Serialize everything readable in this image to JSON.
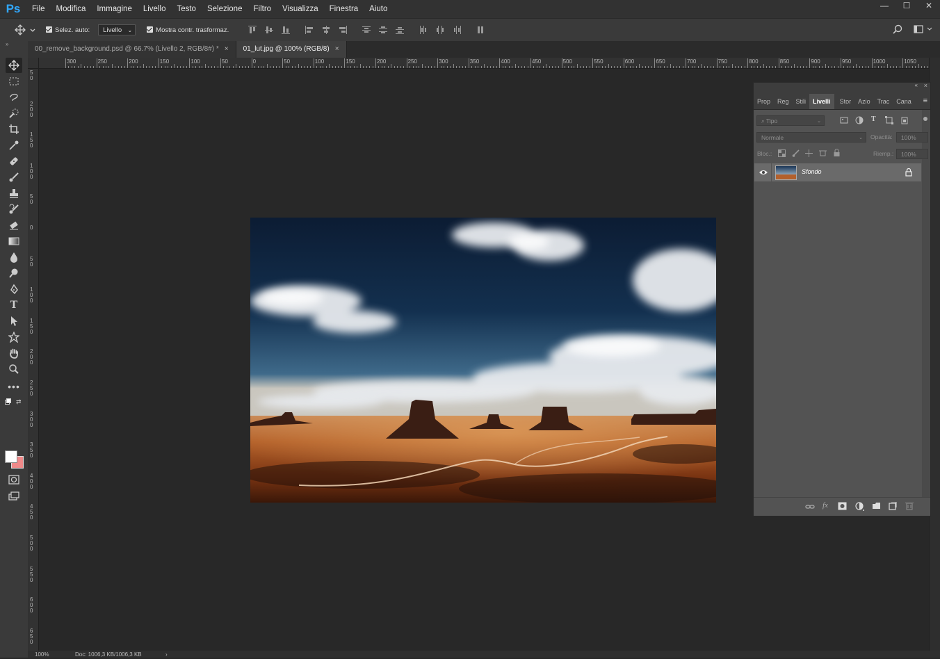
{
  "app": {
    "logo": "Ps"
  },
  "menu": [
    "File",
    "Modifica",
    "Immagine",
    "Livello",
    "Testo",
    "Selezione",
    "Filtro",
    "Visualizza",
    "Finestra",
    "Aiuto"
  ],
  "window_controls": {
    "minimize": "—",
    "maximize": "☐",
    "close": "✕"
  },
  "options": {
    "auto_select_label": "Selez. auto:",
    "auto_select_value": "Livello",
    "show_transform_label": "Mostra contr. trasformaz."
  },
  "tabs": [
    {
      "label": "00_remove_background.psd @ 66.7% (Livello 2, RGB/8#) *",
      "close": "×"
    },
    {
      "label": "01_lut.jpg @ 100% (RGB/8)",
      "close": "×"
    }
  ],
  "ruler_h": [
    "300",
    "250",
    "200",
    "150",
    "100",
    "50",
    "0",
    "50",
    "100",
    "150",
    "200",
    "250",
    "300",
    "350",
    "400",
    "450",
    "500",
    "550",
    "600",
    "650",
    "700",
    "750",
    "800",
    "850",
    "900",
    "950",
    "1000",
    "1050"
  ],
  "ruler_v": [
    "50",
    "200",
    "150",
    "100",
    "50",
    "0",
    "50",
    "100",
    "150",
    "200",
    "250",
    "300",
    "350",
    "400",
    "450",
    "500",
    "550",
    "600",
    "650"
  ],
  "panel": {
    "tabs": [
      "Prop",
      "Reg",
      "Stili",
      "Livelli",
      "Stor",
      "Azio",
      "Trac",
      "Cana"
    ],
    "active_tab": "Livelli",
    "filter_placeholder": "Tipo",
    "blend_mode": "Normale",
    "opacity_label": "Opacità:",
    "opacity_value": "100%",
    "lock_label": "Bloc.:",
    "fill_label": "Riemp.:",
    "fill_value": "100%",
    "layers": [
      {
        "name": "Sfondo",
        "visible": true,
        "locked": true
      }
    ]
  },
  "status": {
    "zoom": "100%",
    "doc": "Doc: 1006,3 KB/1006,3 KB"
  }
}
